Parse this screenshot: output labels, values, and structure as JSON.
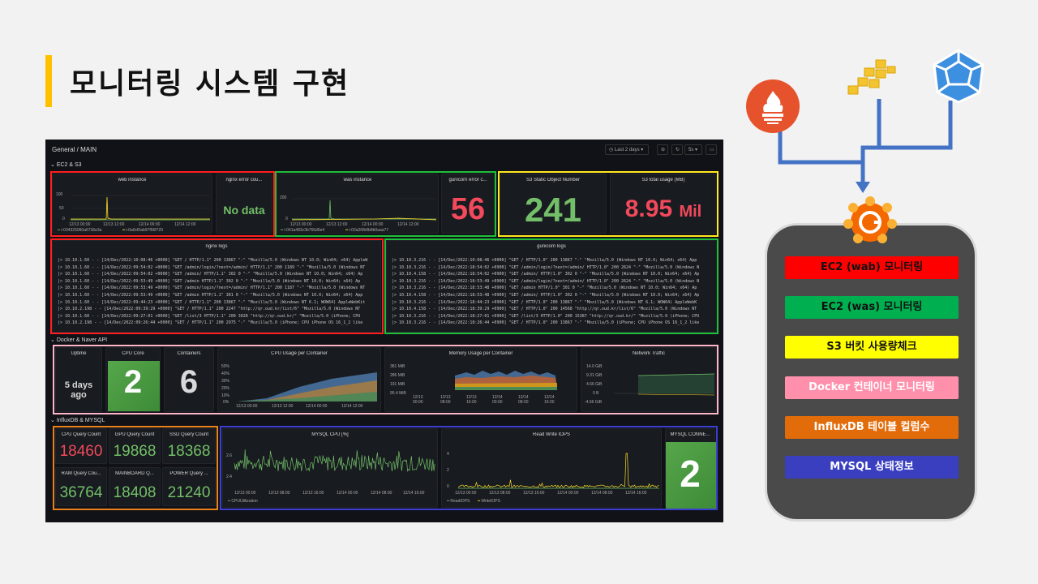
{
  "slide": {
    "title": "모니터링 시스템 구현"
  },
  "dashboard": {
    "breadcrumb": "General / MAIN",
    "time_range": "Last 2 days",
    "refresh": "5s",
    "sections": {
      "ec2": "EC2 & S3",
      "docker": "Docker & Naver API",
      "influx": "InfluxDB & MYSQL"
    },
    "panels": {
      "web_instance": {
        "title": "web instance",
        "y_ticks": [
          "100",
          "50",
          "0"
        ],
        "x_ticks": [
          "12/13 00:00",
          "12/13 12:00",
          "12/14 00:00",
          "12/14 12:00"
        ],
        "legend": [
          "i-034325060a6736e3a",
          "i-0a0cf0ab97f56f729"
        ]
      },
      "nginx_error": {
        "title": "nginx error cou...",
        "value": "No data"
      },
      "was_instance": {
        "title": "was instance",
        "y_ticks": [
          "200",
          "0"
        ],
        "x_ticks": [
          "12/13 00:00",
          "12/13 12:00",
          "12/14 00:00",
          "12/14 12:00"
        ],
        "legend": [
          "i-041a483c3b766d5e4",
          "i-02a26fb9b8b0aaa77"
        ]
      },
      "gunicorn_error": {
        "title": "gunicorn error c...",
        "value": "56"
      },
      "s3_objects": {
        "title": "S3 Static Object Number",
        "value": "241"
      },
      "s3_usage": {
        "title": "S3 total usage (MB)",
        "value": "8.95",
        "unit": "Mil"
      },
      "nginx_logs": {
        "title": "nginx logs",
        "lines": [
          "|> 10.10.1.60 - - [14/Dec/2022:10:08:46 +0000] \"GET / HTTP/1.1\" 200 13867 \"-\" \"Mozilla/5.0 (Windows NT 10.0; Win64; x64) AppleW",
          "|> 10.10.1.60 - - [14/Dec/2022:09:54:02 +0000] \"GET /admin/login/?next=/admin/ HTTP/1.1\" 200 1189 \"-\" \"Mozilla/5.0 (Windows NT",
          "|> 10.10.1.60 - - [14/Dec/2022:09:54:02 +0000] \"GET /admin/ HTTP/1.1\" 302 0 \"-\" \"Mozilla/5.0 (Windows NT 10.0; Win64; x64) Ap",
          "|> 10.10.1.60 - - [14/Dec/2022:09:53:49 +0000] \"GET /admin HTTP/1.1\" 302 0 \"-\" \"Mozilla/5.0 (Windows NT 10.0; Win64; x64) Ap",
          "|> 10.10.1.60 - - [14/Dec/2022:09:53:49 +0000] \"GET /admin/login/?next=/admin/ HTTP/1.1\" 200 1187 \"-\" \"Mozilla/5.0 (Windows NT",
          "|> 10.10.1.60 - - [14/Dec/2022:09:53:49 +0000] \"GET /admin HTTP/1.1\" 301 0 \"-\" \"Mozilla/5.0 (Windows NT 10.0; Win64; x64) App",
          "|> 10.10.1.60 - - [14/Dec/2022:09:44:23 +0000] \"GET / HTTP/1.1\" 200 13867 \"-\" \"Mozilla/5.0 (Windows NT 6.1; WOW64) AppleWebKit",
          "|> 10.10.2.198 - - [14/Dec/2022:09:39:29 +0000] \"GET / HTTP/1.1\" 200 2247 \"http://qr.oud.kr/list/6\" \"Mozilla/5.0 (Windows NT",
          "|> 10.10.1.60 - - [14/Dec/2022:09:27:01 +0000] \"GET /list/3 HTTP/1.1\" 200 3028 \"http://qr.oud.kr/\" \"Mozilla/5.0 (iPhone; CPU",
          "|> 10.10.2.198 - - [14/Dec/2022:09:26:44 +0000] \"GET / HTTP/1.1\" 200 2975 \"-\" \"Mozilla/5.0 (iPhone; CPU iPhone OS 16_1_2 like"
        ]
      },
      "gunicorn_logs": {
        "title": "gunicorn logs",
        "lines": [
          "|> 10.10.3.216 - - [14/Dec/2022:10:08:46 +0000] \"GET / HTTP/1.0\" 200 13867 \"-\" \"Mozilla/5.0 (Windows NT 10.0; Win64; x64) App",
          "|> 10.10.3.216 - - [14/Dec/2022:18:54:02 +0900] \"GET /admin/login/?next=/admin/ HTTP/1.0\" 200 2624 \"-\" \"Mozilla/5.0 (Windows N",
          "|> 10.10.4.158 - - [14/Dec/2022:18:54:02 +0900] \"GET /admin/ HTTP/1.0\" 302 0 \"-\" \"Mozilla/5.0 (Windows NT 10.0; Win64; x64) Ap",
          "|> 10.10.3.216 - - [14/Dec/2022:18:53:49 +0900] \"GET /admin/login/?next=/admin/ HTTP/1.0\" 200 2624 \"-\" \"Mozilla/5.0 (Windows N",
          "|> 10.10.3.216 - - [14/Dec/2022:18:53:48 +0900] \"GET /admin HTTP/1.0\" 301 0 \"-\" \"Mozilla/5.0 (Windows NT 10.0; Win64; x64) Ap",
          "|> 10.10.4.158 - - [14/Dec/2022:18:53:48 +0900] \"GET /admin/ HTTP/1.0\" 302 0 \"-\" \"Mozilla/5.0 (Windows NT 10.0; Win64; x64) Ap",
          "|> 10.10.3.216 - - [14/Dec/2022:18:44:23 +0900] \"GET / HTTP/1.0\" 200 13867 \"-\" \"Mozilla/5.0 (Windows NT 6.1; WOW64) AppleWebK",
          "|> 10.10.4.158 - - [14/Dec/2022:18:39:29 +0900] \"GET / HTTP/1.0\" 200 14568 \"http://qr.oud.kr/list/6\" \"Mozilla/5.0 (Windows NT",
          "|> 10.10.3.216 - - [14/Dec/2022:18:27:01 +0900] \"GET /list/3 HTTP/1.0\" 200 15387 \"http://qr.oud.kr/\" \"Mozilla/5.0 (iPhone; CPU",
          "|> 10.10.3.216 - - [14/Dec/2022:18:26:44 +0900] \"GET / HTTP/1.0\" 200 13867 \"-\" \"Mozilla/5.0 (iPhone; CPU iPhone OS 16_1_2 like"
        ]
      },
      "uptime": {
        "title": "Uptime",
        "value": "5 days ago"
      },
      "cpu_core": {
        "title": "CPU Core",
        "value": "2"
      },
      "containers": {
        "title": "Containers",
        "value": "6"
      },
      "cpu_container": {
        "title": "CPU Usage per Container",
        "y_ticks": [
          "50%",
          "40%",
          "30%",
          "20%",
          "10%",
          "0%"
        ],
        "x_ticks": [
          "12/13 00:00",
          "12/13 12:00",
          "12/14 00:00",
          "12/14 12:00"
        ]
      },
      "mem_container": {
        "title": "Memory Usage per Container",
        "y_ticks": [
          "381 MiB",
          "286 MiB",
          "191 MiB",
          "95.4 MiB"
        ],
        "x_ticks": [
          "12/13\n00:00",
          "12/13\n08:00",
          "12/13\n16:00",
          "12/14\n00:00",
          "12/14\n08:00",
          "12/14\n16:00"
        ]
      },
      "network": {
        "title": "Network Traffic",
        "y_ticks": [
          "14.0 GiB",
          "9.31 GiB",
          "4.66 GiB",
          "0 B",
          "-4.66 GiB"
        ]
      },
      "cpu_query": {
        "title": "CPU Query Count",
        "value": "18460"
      },
      "gpu_query": {
        "title": "GPU Query Count",
        "value": "19868"
      },
      "ssd_query": {
        "title": "SSD Query Count",
        "value": "18368"
      },
      "ram_query": {
        "title": "RAM Query Cou...",
        "value": "36764"
      },
      "mainboard_query": {
        "title": "MAINBOARD Q...",
        "value": "18408"
      },
      "power_query": {
        "title": "POWER Query ...",
        "value": "21240"
      },
      "mysql_cpu": {
        "title": "MYSQL CPU [%]",
        "y_ticks": [
          "2.6",
          "2.4"
        ],
        "x_ticks": [
          "12/13 00:00",
          "12/13 08:00",
          "12/13 16:00",
          "12/14 00:00",
          "12/14 08:00",
          "12/14 16:00"
        ],
        "legend": "CPUUtilization"
      },
      "rw_iops": {
        "title": "Read Write IOPS",
        "y_ticks": [
          "4",
          "2",
          "0"
        ],
        "x_ticks": [
          "12/13 00:00",
          "12/13 08:00",
          "12/13 16:00",
          "12/14 00:00",
          "12/14 08:00",
          "12/14 16:00"
        ],
        "legend": [
          "ReadIOPS",
          "WriteIOPS"
        ]
      },
      "mysql_conn": {
        "title": "MYSQL CONNE...",
        "value": "2"
      }
    }
  },
  "legend_box": {
    "items": [
      {
        "label": "EC2 (wab) 모니터링",
        "bg": "#ff0000",
        "fg": "#111111"
      },
      {
        "label": "EC2 (was) 모니터링",
        "bg": "#00b050",
        "fg": "#111111"
      },
      {
        "label": "S3 버킷 사용량체크",
        "bg": "#ffff00",
        "fg": "#111111"
      },
      {
        "label": "Docker 컨테이너 모니터링",
        "bg": "#ff8fab",
        "fg": "#ffffff"
      },
      {
        "label": "InfluxDB 테이블 컬럼수",
        "bg": "#e36c0a",
        "fg": "#ffffff"
      },
      {
        "label": "MYSQL 상태정보",
        "bg": "#3a3fc0",
        "fg": "#ffffff"
      }
    ]
  },
  "colors": {
    "accent": "#ffc000",
    "green": "#73bf69",
    "red": "#f2495c",
    "connector": "#4472c4"
  }
}
